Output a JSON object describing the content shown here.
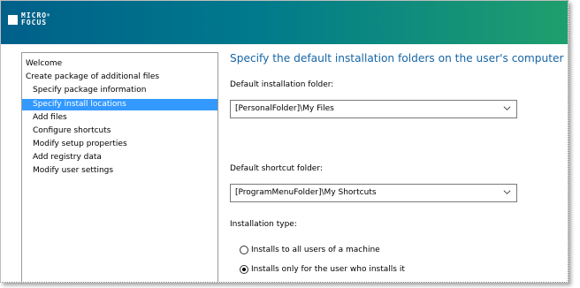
{
  "brand": {
    "logo_line1": "MICRO",
    "logo_line2": "FOCUS",
    "trademark": "®"
  },
  "steps": [
    {
      "label": "Welcome"
    },
    {
      "label": "Create package of additional files"
    },
    {
      "label": "Specify package information"
    },
    {
      "label": "Specify install locations",
      "selected": true
    },
    {
      "label": "Add files"
    },
    {
      "label": "Configure shortcuts"
    },
    {
      "label": "Modify setup properties"
    },
    {
      "label": "Add registry data"
    },
    {
      "label": "Modify user settings"
    }
  ],
  "main": {
    "heading": "Specify the default installation folders on the user's computer",
    "install_folder": {
      "label": "Default installation folder:",
      "value": "[PersonalFolder]\\My Files"
    },
    "shortcut_folder": {
      "label": "Default shortcut folder:",
      "value": "[ProgramMenuFolder]\\My Shortcuts"
    },
    "install_type": {
      "label": "Installation type:",
      "options": [
        {
          "label": "Installs to all users of a machine",
          "checked": false
        },
        {
          "label": "Installs only for the user who installs it",
          "checked": true
        }
      ]
    }
  },
  "colors": {
    "selection": "#3399ff",
    "heading": "#1565a6",
    "banner_start": "#00608a",
    "banner_end": "#1f9f6d"
  },
  "icons": {
    "dropdown": "chevron-down-icon",
    "logo": "micro-focus-logo"
  }
}
